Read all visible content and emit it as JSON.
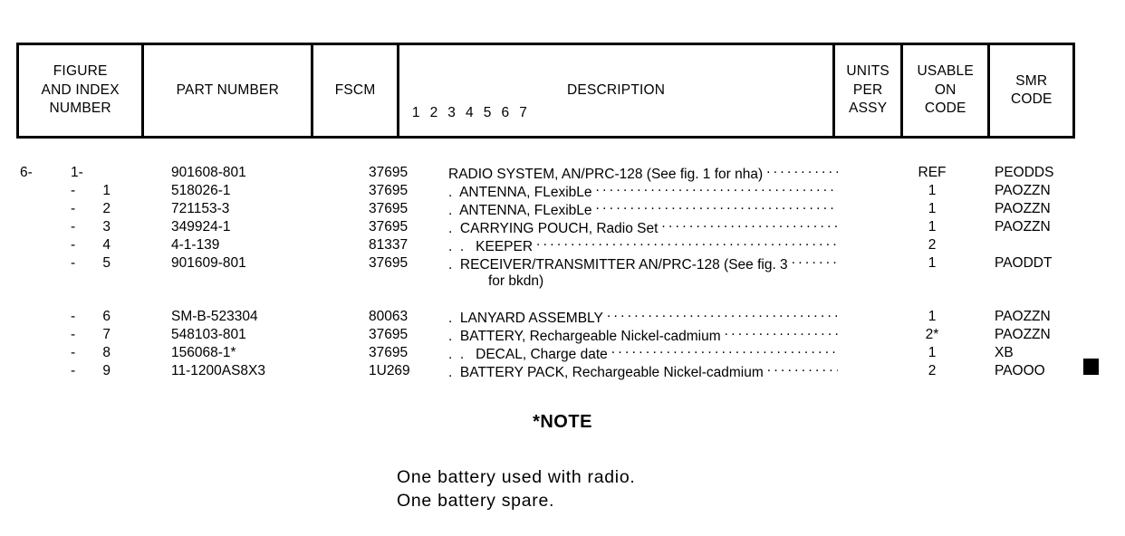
{
  "table": {
    "headers": {
      "figure_and_index": [
        "FIGURE",
        "AND INDEX",
        "NUMBER"
      ],
      "part_number": "PART NUMBER",
      "fscm": "FSCM",
      "description": "DESCRIPTION",
      "description_indent_levels": "1 2 3 4 5 6 7",
      "units_per_assy": [
        "UNITS",
        "PER",
        "ASSY"
      ],
      "usable_on_code": [
        "USABLE",
        "ON",
        "CODE"
      ],
      "smr_code": [
        "SMR",
        "CODE"
      ]
    },
    "rows": [
      {
        "figure": "6-",
        "dash": "1-",
        "index": "",
        "part_number": "901608-801",
        "fscm": "37695",
        "description": "RADIO SYSTEM, AN/PRC-128 (See fig. 1 for nha)",
        "leader": true,
        "units_per_assy": "REF",
        "usable_on_code": "",
        "smr_code": "PEODDS"
      },
      {
        "figure": "",
        "dash": "-",
        "index": "1",
        "part_number": "518026-1",
        "fscm": "37695",
        "description": ".  ANTENNA, FLexibLe",
        "leader": true,
        "units_per_assy": "1",
        "usable_on_code": "",
        "smr_code": "PAOZZN"
      },
      {
        "figure": "",
        "dash": "-",
        "index": "2",
        "part_number": "721153-3",
        "fscm": "37695",
        "description": ".  ANTENNA, FLexibLe",
        "leader": true,
        "units_per_assy": "1",
        "usable_on_code": "",
        "smr_code": "PAOZZN"
      },
      {
        "figure": "",
        "dash": "-",
        "index": "3",
        "part_number": "349924-1",
        "fscm": "37695",
        "description": ".  CARRYING POUCH, Radio Set",
        "leader": true,
        "units_per_assy": "1",
        "usable_on_code": "",
        "smr_code": "PAOZZN"
      },
      {
        "figure": "",
        "dash": "-",
        "index": "4",
        "part_number": "4-1-139",
        "fscm": "81337",
        "description": ".  .   KEEPER",
        "leader": true,
        "units_per_assy": "2",
        "usable_on_code": "",
        "smr_code": ""
      },
      {
        "figure": "",
        "dash": "-",
        "index": "5",
        "part_number": "901609-801",
        "fscm": "37695",
        "description": ".  RECEIVER/TRANSMITTER AN/PRC-128 (See fig. 3",
        "leader": true,
        "continuation": "for bkdn)",
        "units_per_assy": "1",
        "usable_on_code": "",
        "smr_code": "PAODDT"
      },
      {
        "figure": "",
        "dash": "-",
        "index": "6",
        "part_number": "SM-B-523304",
        "fscm": "80063",
        "description": ".  LANYARD ASSEMBLY",
        "leader": true,
        "units_per_assy": "1",
        "usable_on_code": "",
        "smr_code": "PAOZZN",
        "group_gap": true
      },
      {
        "figure": "",
        "dash": "-",
        "index": "7",
        "part_number": "548103-801",
        "fscm": "37695",
        "description": ".  BATTERY, Rechargeable Nickel-cadmium",
        "leader": true,
        "units_per_assy": "2*",
        "usable_on_code": "",
        "smr_code": "PAOZZN"
      },
      {
        "figure": "",
        "dash": "-",
        "index": "8",
        "part_number": "156068-1*",
        "fscm": "37695",
        "description": ".  .   DECAL, Charge date",
        "leader": true,
        "units_per_assy": "1",
        "usable_on_code": "",
        "smr_code": "XB"
      },
      {
        "figure": "",
        "dash": "-",
        "index": "9",
        "part_number": "11-1200AS8X3",
        "fscm": "1U269",
        "description": ".  BATTERY PACK, Rechargeable Nickel-cadmium",
        "leader": true,
        "units_per_assy": "2",
        "usable_on_code": "",
        "smr_code": "PAOOO"
      }
    ]
  },
  "note": {
    "heading": "*NOTE",
    "lines": [
      "One battery used with radio.",
      "One battery spare."
    ]
  },
  "colors": {
    "ink": "#000000",
    "paper": "#ffffff"
  }
}
